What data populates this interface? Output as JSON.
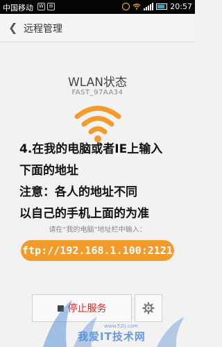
{
  "status_bar": {
    "carrier": "中国移动",
    "time": "20:57"
  },
  "header": {
    "title": "远程管理"
  },
  "main": {
    "wlan_title": "WLAN状态",
    "ssid": "FAST_97AA34",
    "overlay_lines": [
      "4.在我的电脑或者IE上输入",
      "下面的地址",
      "注意：各人的地址不同",
      "以自己的手机上面的为准"
    ],
    "hint": "请在“我的电脑”地址栏中输入：",
    "ftp_address": "ftp://192.168.1.100:2121",
    "stop_label": "停止服务"
  },
  "watermark": {
    "text": "我爱IT技术网",
    "url": "www.52ij.com"
  },
  "colors": {
    "accent": "#f39a2b",
    "stop_red": "#dd2222"
  }
}
